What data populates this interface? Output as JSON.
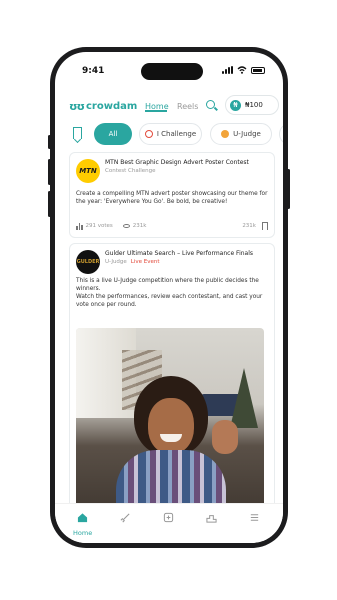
{
  "status": {
    "time": "9:41"
  },
  "header": {
    "logo_mark": "ʊʊ",
    "logo_text": "crowdam",
    "nav_home": "Home",
    "nav_reels": "Reels",
    "wallet_symbol": "₦",
    "wallet_amount": "₦100"
  },
  "filters": {
    "items": [
      {
        "label": "All",
        "active": true
      },
      {
        "label": "I Challenge",
        "active": false
      },
      {
        "label": "U-Judge",
        "active": false
      }
    ]
  },
  "feed": {
    "cards": [
      {
        "avatar_text": "MTN",
        "title": "MTN Best Graphic Design Advert Poster Contest",
        "subtitle": "Contest Challenge",
        "body": "Create a compelling MTN advert poster showcasing our theme for the year: 'Everywhere You Go'. Be bold, be creative!",
        "votes": "291 votes",
        "views": "231k",
        "count": "231k"
      },
      {
        "avatar_text": "GULDER",
        "title": "Gulder Ultimate Search – Live Performance Finals",
        "subtitle": "U-Judge",
        "badge": "Live Event",
        "body_line1": "This is a live U-Judge competition where the public decides the winners.",
        "body_line2": "Watch the performances, review each contestant, and cast your vote once per round."
      }
    ]
  },
  "tabbar": {
    "active_label": "Home",
    "icons": [
      "home-icon",
      "rocket-icon",
      "plus-square-icon",
      "podium-icon",
      "menu-icon"
    ]
  },
  "colors": {
    "accent": "#2aa6a0",
    "live": "#e24a3b"
  }
}
